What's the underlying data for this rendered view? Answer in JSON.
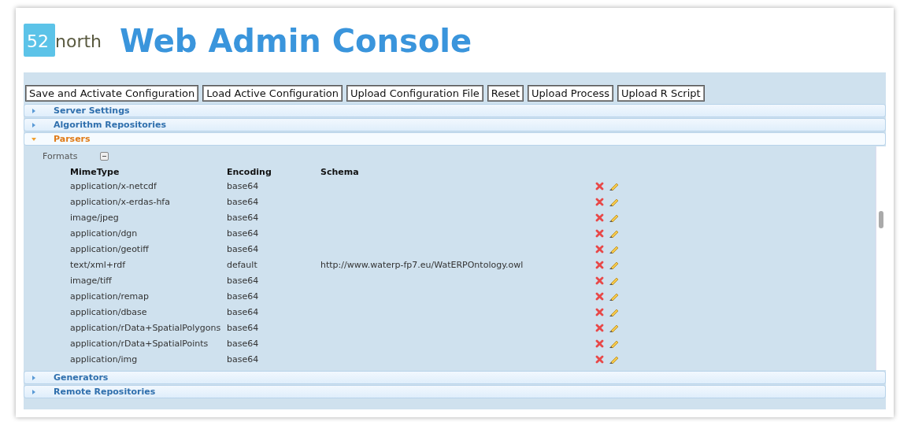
{
  "logo": {
    "prefix": "52",
    "name": "north"
  },
  "title": "Web Admin Console",
  "toolbar": [
    "Save and Activate Configuration",
    "Load Active Configuration",
    "Upload Configuration File",
    "Reset",
    "Upload Process",
    "Upload R Script"
  ],
  "sections_before": [
    {
      "label": "Server Settings",
      "expanded": false
    },
    {
      "label": "Algorithm Repositories",
      "expanded": false
    },
    {
      "label": "Parsers",
      "expanded": true
    }
  ],
  "formats": {
    "label": "Formats",
    "expanded": true,
    "columns": [
      "MimeType",
      "Encoding",
      "Schema"
    ],
    "rows": [
      {
        "mime": "application/x-netcdf",
        "encoding": "base64",
        "schema": ""
      },
      {
        "mime": "application/x-erdas-hfa",
        "encoding": "base64",
        "schema": ""
      },
      {
        "mime": "image/jpeg",
        "encoding": "base64",
        "schema": ""
      },
      {
        "mime": "application/dgn",
        "encoding": "base64",
        "schema": ""
      },
      {
        "mime": "application/geotiff",
        "encoding": "base64",
        "schema": ""
      },
      {
        "mime": "text/xml+rdf",
        "encoding": "default",
        "schema": "http://www.waterp-fp7.eu/WatERPOntology.owl"
      },
      {
        "mime": "image/tiff",
        "encoding": "base64",
        "schema": ""
      },
      {
        "mime": "application/remap",
        "encoding": "base64",
        "schema": ""
      },
      {
        "mime": "application/dbase",
        "encoding": "base64",
        "schema": ""
      },
      {
        "mime": "application/rData+SpatialPolygons",
        "encoding": "base64",
        "schema": ""
      },
      {
        "mime": "application/rData+SpatialPoints",
        "encoding": "base64",
        "schema": ""
      },
      {
        "mime": "application/img",
        "encoding": "base64",
        "schema": ""
      }
    ]
  },
  "sections_after": [
    {
      "label": "Generators",
      "expanded": false
    },
    {
      "label": "Remote Repositories",
      "expanded": false
    }
  ]
}
